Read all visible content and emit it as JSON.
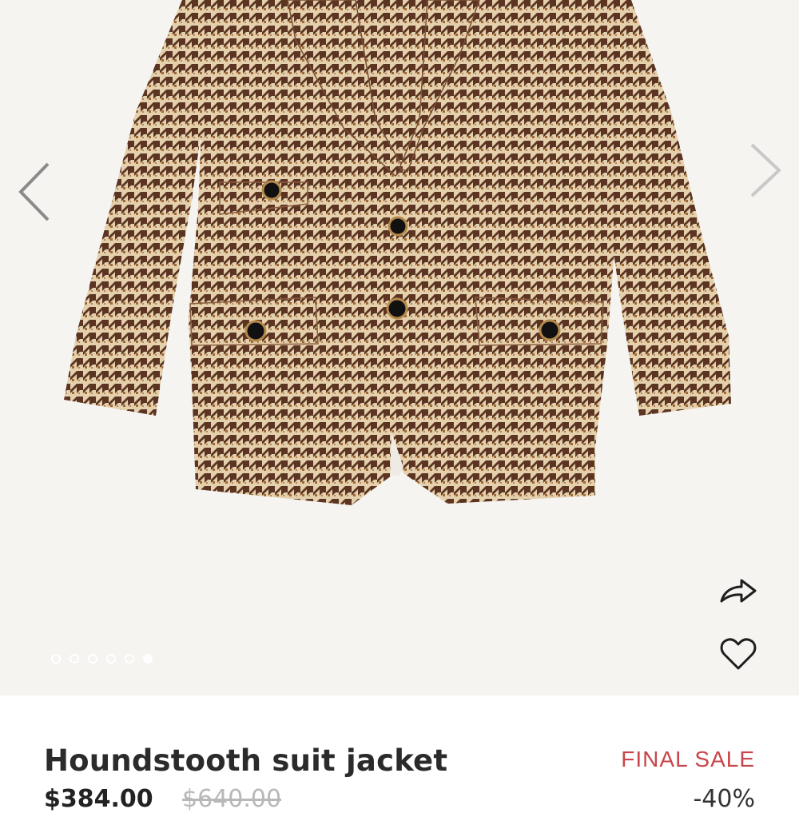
{
  "gallery": {
    "image_alt": "Houndstooth suit jacket",
    "slide_count": 6,
    "active_slide": 6,
    "prev_icon": "chevron-left-icon",
    "next_icon": "chevron-right-icon",
    "share_icon": "share-arrow-icon",
    "wishlist_icon": "heart-icon"
  },
  "product": {
    "title": "Houndstooth suit jacket",
    "badge": "FINAL SALE",
    "price": "$384.00",
    "original_price": "$640.00",
    "discount": "-40%"
  },
  "colors": {
    "badge": "#c8464a",
    "gallery_bg": "#f6f4f1",
    "fabric_light": "#e4d0ad",
    "fabric_dark": "#5c3522",
    "fabric_accent": "#a3662b"
  }
}
